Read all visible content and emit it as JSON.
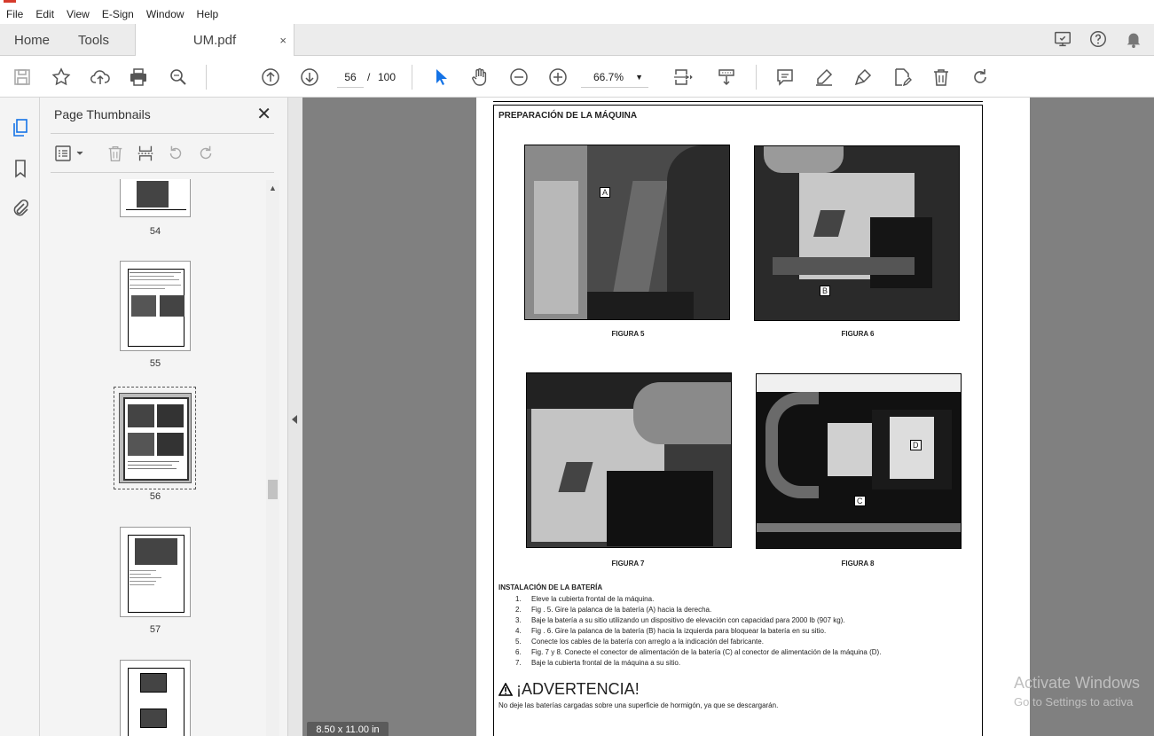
{
  "menu": [
    "File",
    "Edit",
    "View",
    "E-Sign",
    "Window",
    "Help"
  ],
  "tabs": {
    "home": "Home",
    "tools": "Tools",
    "document": "UM.pdf",
    "close_glyph": "×"
  },
  "toolbar": {
    "current_page": "56",
    "separator": "/",
    "total_pages": "100",
    "zoom": "66.7%"
  },
  "thumbnails_panel": {
    "title": "Page Thumbnails",
    "close_glyph": "✕",
    "pages": [
      "54",
      "55",
      "56",
      "57"
    ],
    "selected_page": "56"
  },
  "document": {
    "heading": "PREPARACIÓN DE LA MÁQUINA",
    "figures": [
      {
        "caption": "FIGURA 5",
        "label": "A"
      },
      {
        "caption": "FIGURA 6",
        "label": "B"
      },
      {
        "caption": "FIGURA 7",
        "label": ""
      },
      {
        "caption": "FIGURA 8",
        "label_c": "C",
        "label_d": "D"
      }
    ],
    "install_title": "INSTALACIÓN DE LA BATERÍA",
    "steps": [
      {
        "num": "1.",
        "text": "Eleve la cubierta frontal de la máquina."
      },
      {
        "num": "2.",
        "text": "Fig . 5.  Gire la palanca de la batería (A) hacia la derecha."
      },
      {
        "num": "3.",
        "text": "Baje la batería a su sitio utilizando un dispositivo de elevación con capacidad para 2000 lb (907 kg)."
      },
      {
        "num": "4.",
        "text": "Fig . 6.  Gire la palanca de la batería (B) hacia la izquierda para bloquear la batería en su sitio."
      },
      {
        "num": "5.",
        "text": "Conecte los cables de la batería con arreglo a la indicación del fabricante."
      },
      {
        "num": "6.",
        "text": "Fig. 7 y 8.  Conecte el conector de alimentación de la batería (C) al conector de alimentación de la máquina (D)."
      },
      {
        "num": "7.",
        "text": "Baje la cubierta frontal de la máquina a su sitio."
      }
    ],
    "warning_title": "¡ADVERTENCIA!",
    "warning_text": "No deje las baterías cargadas sobre una superficie de hormigón, ya que se descargarán."
  },
  "status": {
    "page_size": "8.50 x 11.00 in"
  },
  "watermark": {
    "line1": "Activate Windows",
    "line2": "Go to Settings to activa"
  },
  "colors": {
    "accent_blue": "#1473e6",
    "logo_red": "#d63a2b"
  }
}
